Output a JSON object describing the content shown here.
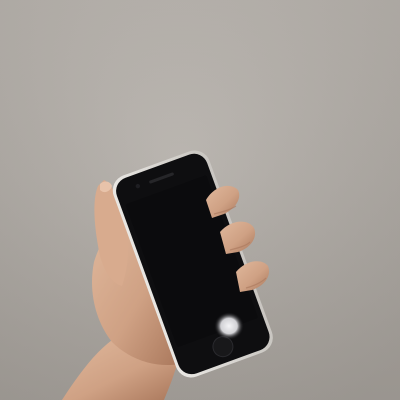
{
  "photo": {
    "subject": "hand-holding-smartphone",
    "colors": {
      "wall_top": "#b9b4ae",
      "wall_bottom": "#a7a29c",
      "skin_light": "#e0b89c",
      "skin_mid": "#cfa184",
      "skin_shadow": "#a9775b",
      "phone_frame": "#e9e7e3",
      "phone_edge": "#c9c6c1",
      "screen": "#0b0b0d",
      "screen_glare": "#f4f4f6",
      "home_button": "#18181a"
    }
  }
}
